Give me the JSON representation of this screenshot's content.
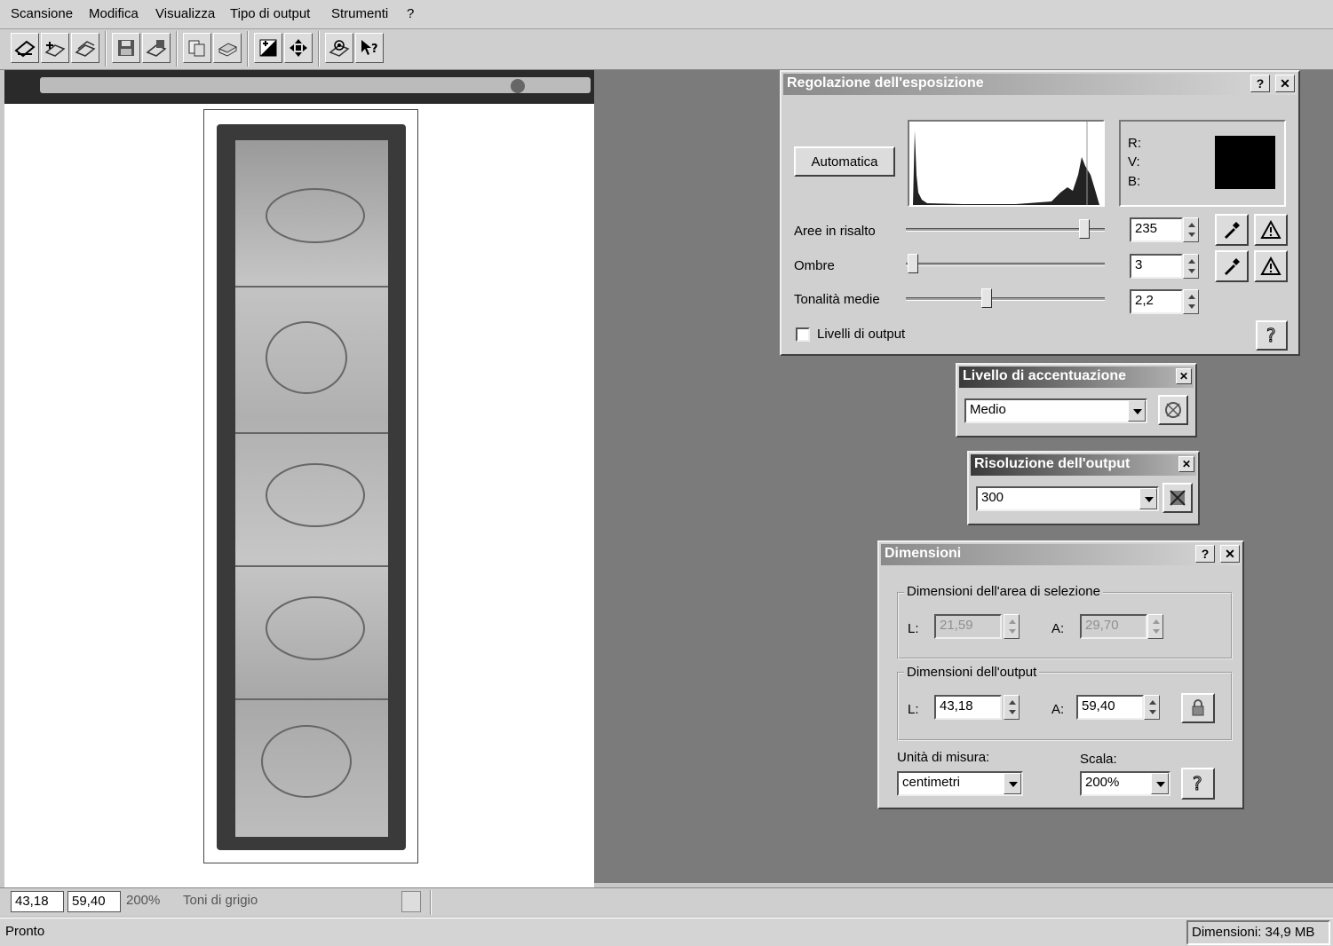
{
  "menu": [
    "Scansione",
    "Modifica",
    "Visualizza",
    "Tipo di output",
    "Strumenti",
    "?"
  ],
  "toolbar_icons": [
    "scan-icon",
    "scan-add-icon",
    "scan-batch-icon",
    "save-icon",
    "save-as-icon",
    "copy-icon",
    "print-icon",
    "exposure-icon",
    "move-icon",
    "settings-icon",
    "help-pointer-icon"
  ],
  "exposure": {
    "title": "Regolazione dell'esposizione",
    "auto_label": "Automatica",
    "rgb_labels": [
      "R:",
      "V:",
      "B:"
    ],
    "highlights_label": "Aree in risalto",
    "highlights_value": "235",
    "highlights_level": 0.92,
    "shadows_label": "Ombre",
    "shadows_value": "3",
    "shadows_level": 0.01,
    "midtones_label": "Tonalità medie",
    "midtones_value": "2,2",
    "midtones_level": 0.4,
    "output_levels_label": "Livelli di output",
    "output_levels_checked": false
  },
  "sharpen": {
    "title": "Livello di accentuazione",
    "value": "Medio"
  },
  "resolution": {
    "title": "Risoluzione dell'output",
    "value": "300"
  },
  "dimensions": {
    "title": "Dimensioni",
    "selection_group": "Dimensioni dell'area di selezione",
    "selection_l_label": "L:",
    "selection_l": "21,59",
    "selection_a_label": "A:",
    "selection_a": "29,70",
    "output_group": "Dimensioni dell'output",
    "output_l_label": "L:",
    "output_l": "43,18",
    "output_a_label": "A:",
    "output_a": "59,40",
    "units_label": "Unità di misura:",
    "units_value": "centimetri",
    "scale_label": "Scala:",
    "scale_value": "200%"
  },
  "infobar": {
    "width": "43,18",
    "height": "59,40",
    "scale": "200%",
    "mode": "Toni di grigio"
  },
  "status": {
    "text": "Pronto",
    "size": "Dimensioni: 34,9 MB"
  }
}
